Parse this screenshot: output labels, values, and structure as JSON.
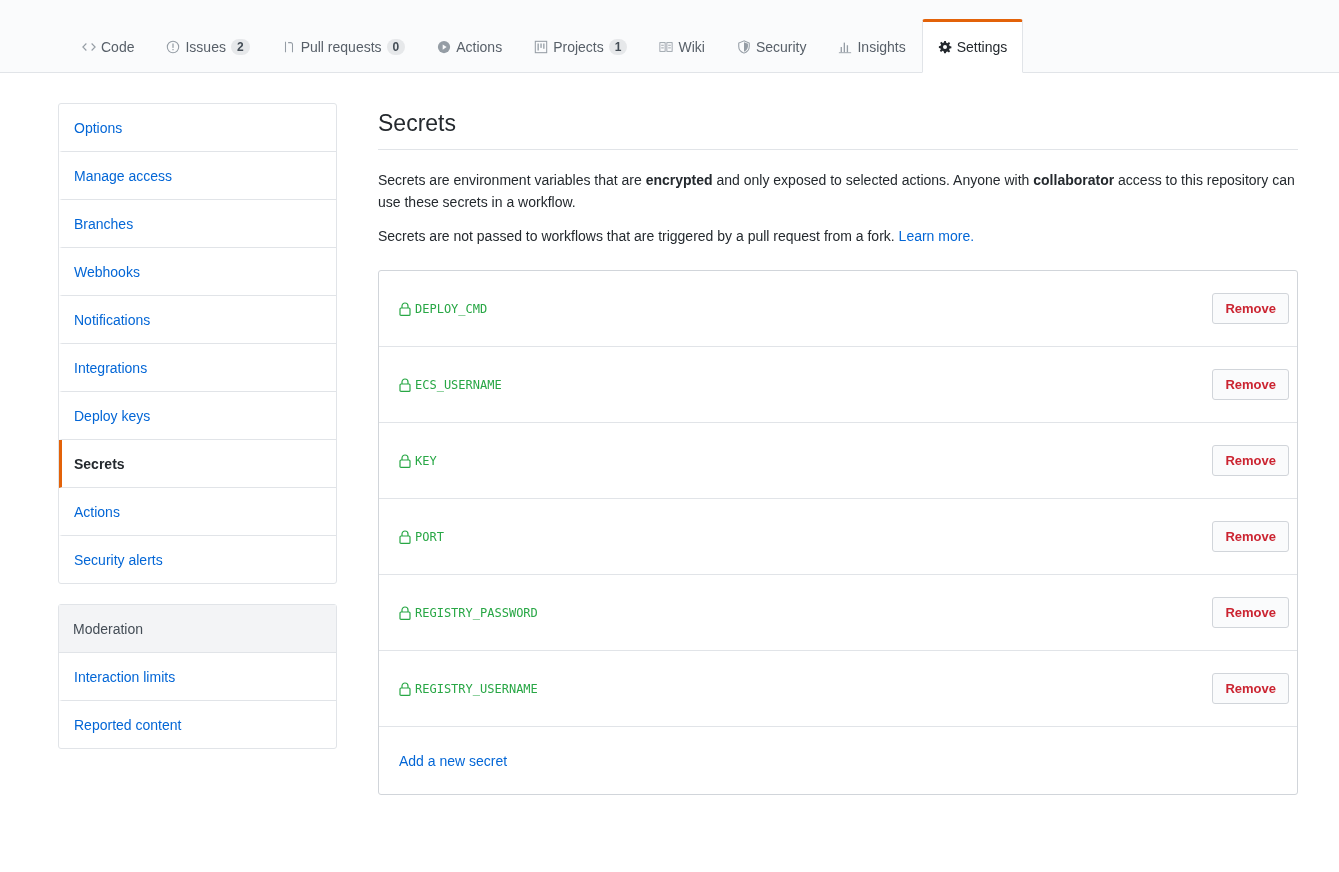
{
  "tabs": [
    {
      "label": "Code",
      "selected": false
    },
    {
      "label": "Issues",
      "count": "2",
      "selected": false
    },
    {
      "label": "Pull requests",
      "count": "0",
      "selected": false
    },
    {
      "label": "Actions",
      "selected": false
    },
    {
      "label": "Projects",
      "count": "1",
      "selected": false
    },
    {
      "label": "Wiki",
      "selected": false
    },
    {
      "label": "Security",
      "selected": false
    },
    {
      "label": "Insights",
      "selected": false
    },
    {
      "label": "Settings",
      "selected": true
    }
  ],
  "sidebar": {
    "groups": [
      {
        "items": [
          {
            "label": "Options",
            "selected": false
          },
          {
            "label": "Manage access",
            "selected": false
          },
          {
            "label": "Branches",
            "selected": false
          },
          {
            "label": "Webhooks",
            "selected": false
          },
          {
            "label": "Notifications",
            "selected": false
          },
          {
            "label": "Integrations",
            "selected": false
          },
          {
            "label": "Deploy keys",
            "selected": false
          },
          {
            "label": "Secrets",
            "selected": true
          },
          {
            "label": "Actions",
            "selected": false
          },
          {
            "label": "Security alerts",
            "selected": false
          }
        ]
      },
      {
        "header": "Moderation",
        "items": [
          {
            "label": "Interaction limits",
            "selected": false
          },
          {
            "label": "Reported content",
            "selected": false
          }
        ]
      }
    ]
  },
  "main": {
    "title": "Secrets",
    "paragraphs": [
      {
        "text": "Secrets are environment variables that are **encrypted** and only exposed to selected actions. Anyone with **collaborator** access to this repository can use these secrets in a workflow."
      },
      {
        "text": "Secrets are not passed to workflows that are triggered by a pull request from a fork.",
        "link": "Learn more."
      }
    ],
    "secrets": [
      {
        "name": "DEPLOY_CMD",
        "action": "Remove"
      },
      {
        "name": "ECS_USERNAME",
        "action": "Remove"
      },
      {
        "name": "KEY",
        "action": "Remove"
      },
      {
        "name": "PORT",
        "action": "Remove"
      },
      {
        "name": "REGISTRY_PASSWORD",
        "action": "Remove"
      },
      {
        "name": "REGISTRY_USERNAME",
        "action": "Remove"
      }
    ],
    "add_link": "Add a new secret"
  }
}
